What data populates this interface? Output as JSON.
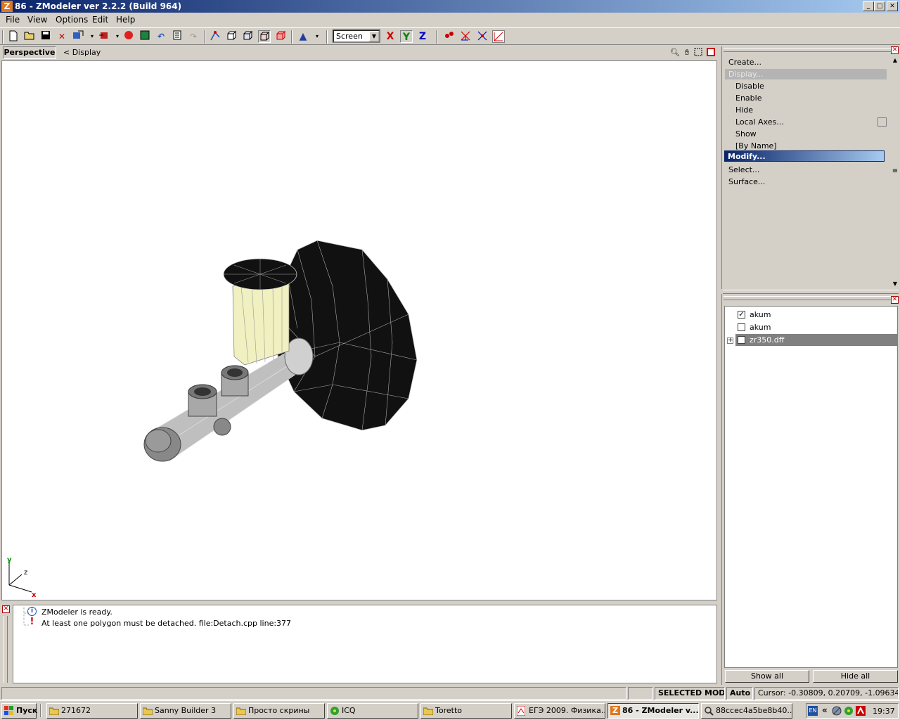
{
  "window": {
    "icon_letter": "Z",
    "title": "86 - ZModeler ver 2.2.2 (Build 964)",
    "controls": [
      "_",
      "□",
      "✕"
    ]
  },
  "menu": [
    {
      "label": "File"
    },
    {
      "label": "View"
    },
    {
      "label": "Options"
    },
    {
      "label": "Edit"
    },
    {
      "label": "Help"
    }
  ],
  "toolbar": {
    "screen_select_value": "Screen",
    "axis_x": "X",
    "axis_y": "Y",
    "axis_z": "Z"
  },
  "viewport": {
    "tab_label": "Perspective",
    "crumb": "<  Display",
    "axes": {
      "y": "y",
      "z": "z",
      "x": "x"
    }
  },
  "command_panel": {
    "items": [
      {
        "label": "Create..."
      },
      {
        "label": "Display..."
      },
      {
        "label": "Disable"
      },
      {
        "label": "Enable"
      },
      {
        "label": "Hide"
      },
      {
        "label": "Local Axes..."
      },
      {
        "label": "Show"
      },
      {
        "label": "[By Name]"
      },
      {
        "label": "Modify..."
      },
      {
        "label": "Select..."
      },
      {
        "label": "Surface..."
      }
    ]
  },
  "object_tree": {
    "rows": [
      {
        "label": "akum",
        "checked": true
      },
      {
        "label": "akum",
        "checked": false
      },
      {
        "label": "zr350.dff",
        "checked": false,
        "selected": true
      }
    ],
    "show_all": "Show all",
    "hide_all": "Hide all"
  },
  "log": {
    "lines": [
      {
        "icon": "info-icon",
        "text": "ZModeler is ready."
      },
      {
        "icon": "warning-icon",
        "text": "At least one polygon must be detached. file:Detach.cpp line:377"
      }
    ]
  },
  "status": {
    "mode": "SELECTED MODE",
    "auto": "Auto",
    "cursor": "Cursor: -0.30809, 0.20709, -1.09634"
  },
  "taskbar": {
    "start": "Пуск",
    "tasks": [
      {
        "label": "271672"
      },
      {
        "label": "Sanny Builder 3"
      },
      {
        "label": "Просто скрины"
      },
      {
        "label": "ICQ"
      },
      {
        "label": "Toretto"
      },
      {
        "label": "ЕГЭ 2009. Физика..."
      },
      {
        "label": "86 - ZModeler v..."
      },
      {
        "label": "88ccec4a5be8b40..."
      }
    ],
    "lang": "EN",
    "clock": "19:37"
  },
  "colors": {
    "title_start": "#0a246a",
    "title_end": "#a6caf0",
    "face": "#d4d0c8",
    "reservoir": "#f0f0c0",
    "booster": "#111111"
  }
}
